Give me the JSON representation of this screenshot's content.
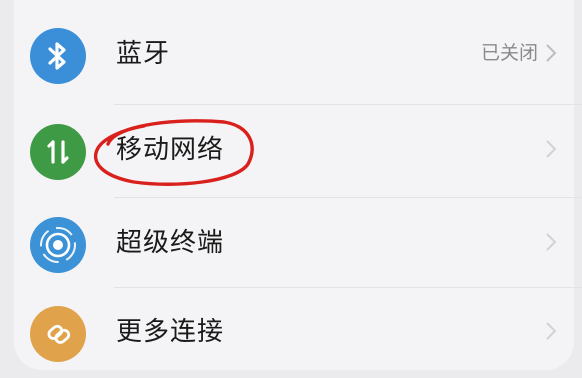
{
  "settings": {
    "items": [
      {
        "label": "蓝牙",
        "value": "已关闭",
        "icon": "bluetooth-icon",
        "color": "#3a8fd8"
      },
      {
        "label": "移动网络",
        "value": "",
        "icon": "mobile-network-icon",
        "color": "#3f9a45"
      },
      {
        "label": "超级终端",
        "value": "",
        "icon": "super-device-icon",
        "color": "#3c92d6"
      },
      {
        "label": "更多连接",
        "value": "",
        "icon": "more-connections-icon",
        "color": "#e0a24a"
      }
    ]
  },
  "annotation": {
    "color": "#d9201c"
  }
}
